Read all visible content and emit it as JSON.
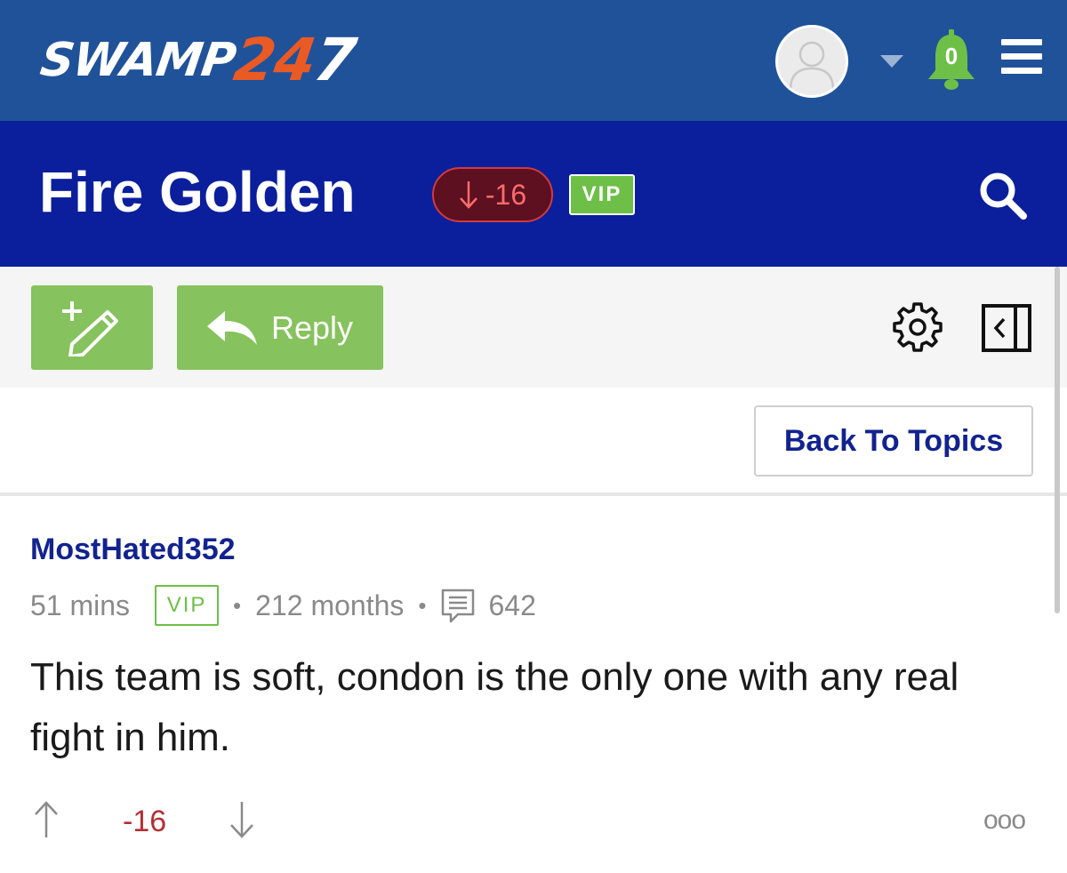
{
  "header": {
    "logo_main": "SWAMP",
    "logo_number_orange": "24",
    "logo_number_white": "7",
    "notification_count": "0",
    "icons": [
      "user-avatar-icon",
      "chevron-down-icon",
      "bell-icon",
      "hamburger-menu-icon"
    ],
    "colors": {
      "bar": "#20529a",
      "logo_accent": "#ea5a24",
      "bell": "#6dbf47"
    }
  },
  "topic": {
    "title": "Fire Golden",
    "vote_score": "-16",
    "badge": "VIP",
    "icons": [
      "down-arrow-icon",
      "search-icon"
    ],
    "colors": {
      "bar": "#0b1f9c",
      "negative": "#d33a3a",
      "vip": "#6dbf47"
    }
  },
  "toolbar": {
    "reply_label": "Reply",
    "icons": [
      "new-post-pencil-icon",
      "reply-arrow-icon",
      "gear-icon",
      "collapse-panel-icon"
    ],
    "colors": {
      "button": "#86c25d"
    }
  },
  "navigation": {
    "back_label": "Back To Topics"
  },
  "post": {
    "username": "MostHated352",
    "time_ago": "51 mins",
    "badge": "VIP",
    "membership": "212 months",
    "post_count": "642",
    "separator": "•",
    "body": "This team is soft, condon is the only one with any real fight in him.",
    "score": "-16",
    "more_label": "ooo",
    "icons": [
      "comment-icon",
      "upvote-arrow-icon",
      "downvote-arrow-icon"
    ],
    "colors": {
      "username": "#12238f",
      "score": "#b62f33"
    }
  }
}
